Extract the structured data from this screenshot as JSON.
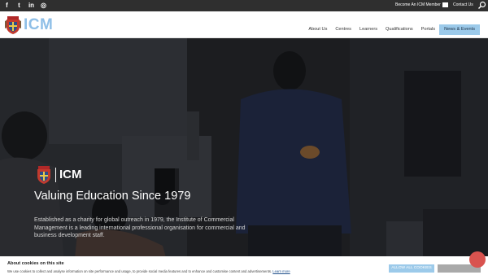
{
  "topbar": {
    "social": [
      {
        "icon": "facebook-icon",
        "glyph": "f"
      },
      {
        "icon": "twitter-icon",
        "glyph": "t"
      },
      {
        "icon": "linkedin-icon",
        "glyph": "in"
      },
      {
        "icon": "instagram-icon",
        "glyph": "◎"
      }
    ],
    "become_member": "Become An ICM Member",
    "contact": "Contact Us"
  },
  "nav": {
    "logo_text": "ICM",
    "menu": [
      "About Us",
      "Centres",
      "Learners",
      "Qualifications",
      "Portals",
      "News & Events"
    ],
    "active_item": "News & Events",
    "accent_color": "#9ccaea"
  },
  "hero": {
    "logo_text": "ICM",
    "heading": "Valuing Education Since 1979",
    "description": "Established as a charity for global outreach in 1979, the Institute of Commercial Management is a leading international professional organisation for commercial and business development staff."
  },
  "cookie": {
    "title": "About cookies on this site",
    "message": "We use cookies to collect and analyse information on site performance and usage, to provide social media features and to enhance and customise content and advertisements.",
    "learn_more": "Learn more",
    "allow_all": "ALLOW ALL COOKIES"
  }
}
